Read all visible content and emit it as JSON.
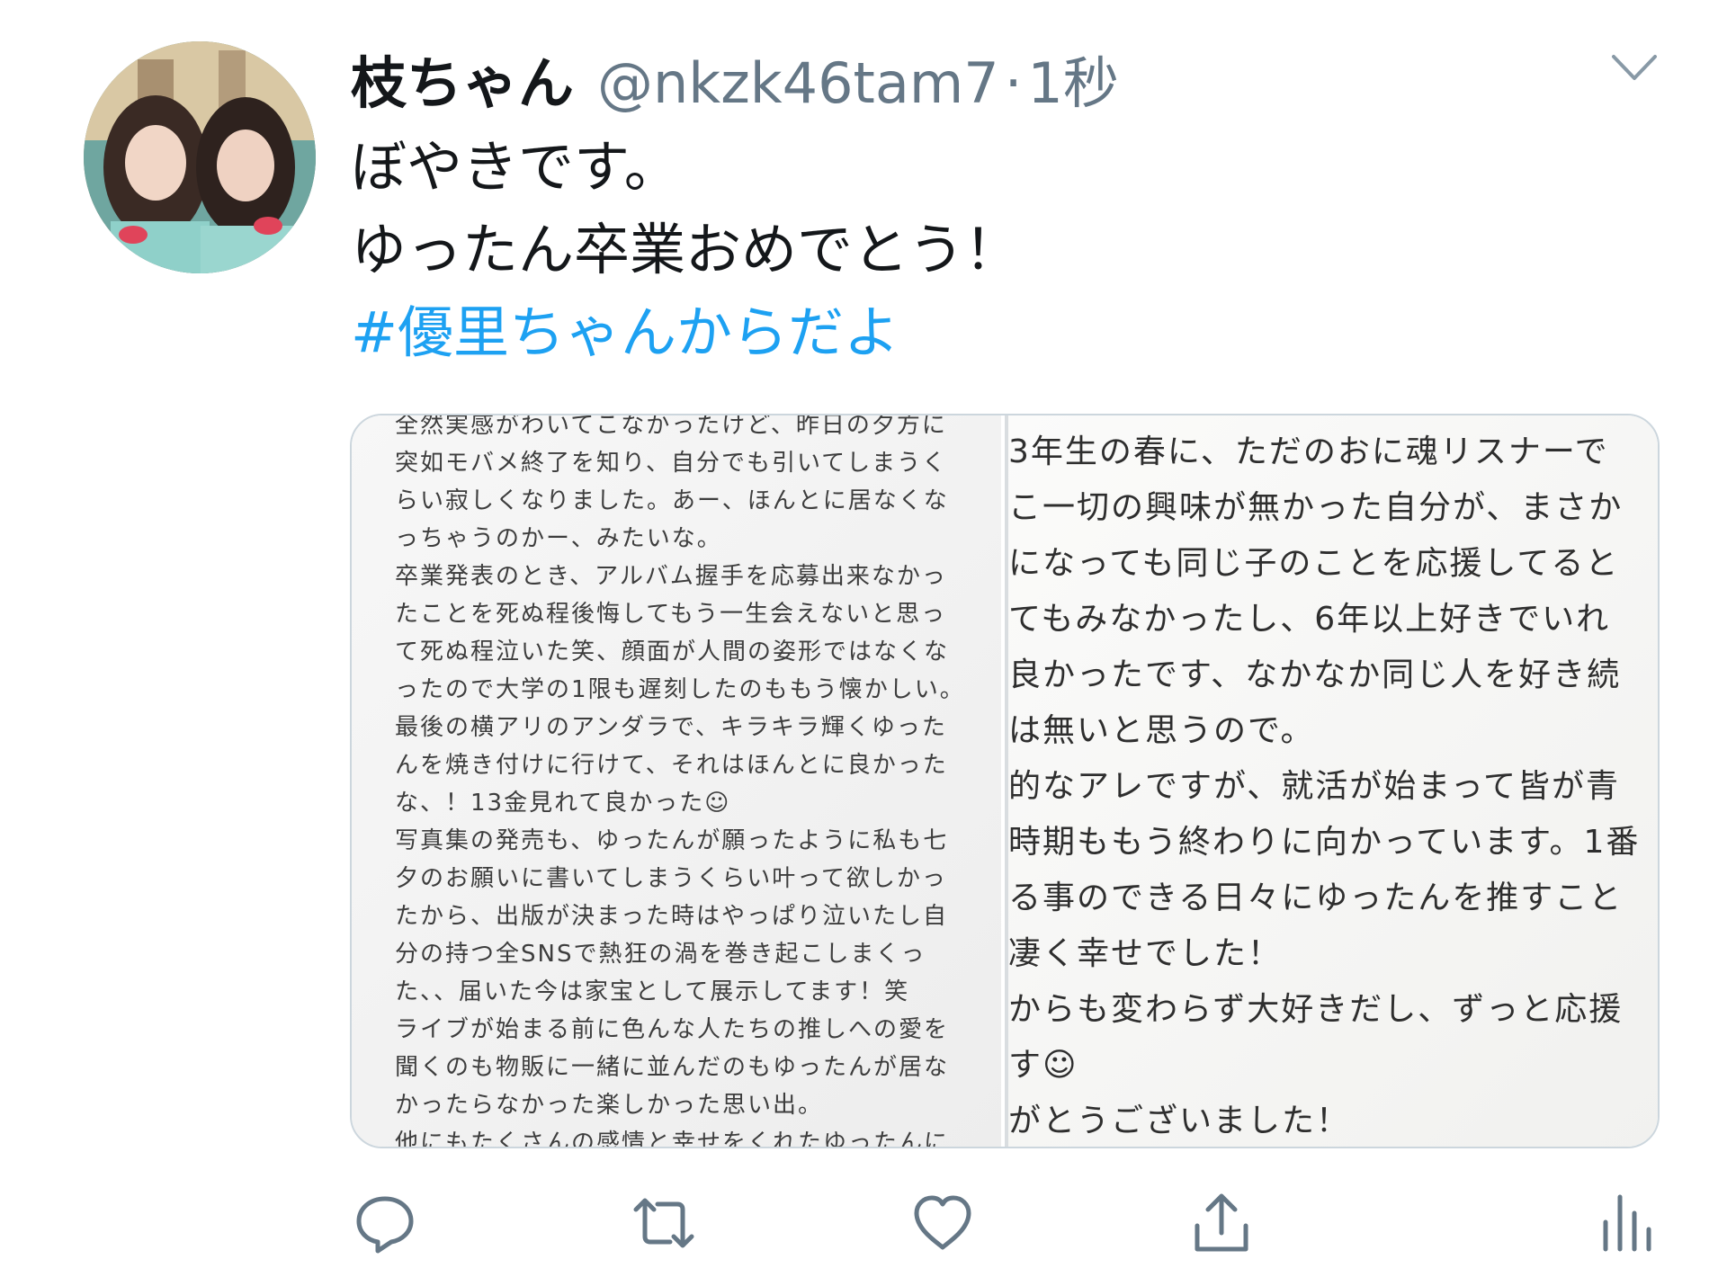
{
  "tweet": {
    "display_name": "枝ちゃん",
    "handle": "@nkzk46tam7",
    "separator": "·",
    "time": "1秒",
    "text_lines": [
      "ぼやきです。",
      "ゆったん卒業おめでとう！"
    ],
    "hashtag": "#優里ちゃんからだよ"
  },
  "media": {
    "left_lines": [
      "全然実感がわいてこなかったけど、昨日の夕方に",
      "突如モバメ終了を知り、自分でも引いてしまうく",
      "らい寂しくなりました。あー、ほんとに居なくな",
      "っちゃうのかー、みたいな。",
      "卒業発表のとき、アルバム握手を応募出来なかっ",
      "たことを死ぬ程後悔してもう一生会えないと思っ",
      "て死ぬ程泣いた笑、顔面が人間の姿形ではなくな",
      "ったので大学の1限も遅刻したのももう懐かしい。",
      "最後の横アリのアンダラで、キラキラ輝くゆった",
      "んを焼き付けに行けて、それはほんとに良かった",
      "な、！13金見れて良かった☺",
      "写真集の発売も、ゆったんが願ったように私も七",
      "夕のお願いに書いてしまうくらい叶って欲しかっ",
      "たから、出版が決まった時はやっぱり泣いたし自",
      "分の持つ全SNSで熱狂の渦を巻き起こしまくっ",
      "た、、届いた今は家宝として展示してます！笑",
      "ライブが始まる前に色んな人たちの推しへの愛を",
      "聞くのも物販に一緒に並んだのもゆったんが居な",
      "かったらなかった楽しかった思い出。",
      "他にもたくさんの感情と幸せをくれたゆったんに"
    ],
    "right_lines": [
      "3年生の春に、ただのおに魂リスナーで",
      "こ一切の興味が無かった自分が、まさか",
      "になっても同じ子のことを応援してると",
      "てもみなかったし、6年以上好きでいれ",
      "良かったです、なかなか同じ人を好き続",
      "は無いと思うので。",
      "的なアレですが、就活が始まって皆が青",
      "時期ももう終わりに向かっています。1番",
      "る事のできる日々にゆったんを推すこと",
      "凄く幸せでした！",
      "からも変わらず大好きだし、ずっと応援",
      "す☺",
      "がとうございました！"
    ]
  },
  "colors": {
    "hashtag": "#1da1f2",
    "secondary_text": "#657786",
    "icon": "#657786"
  },
  "icons": [
    "chevron-down-icon",
    "reply-icon",
    "retweet-icon",
    "like-icon",
    "share-icon",
    "analytics-icon"
  ]
}
